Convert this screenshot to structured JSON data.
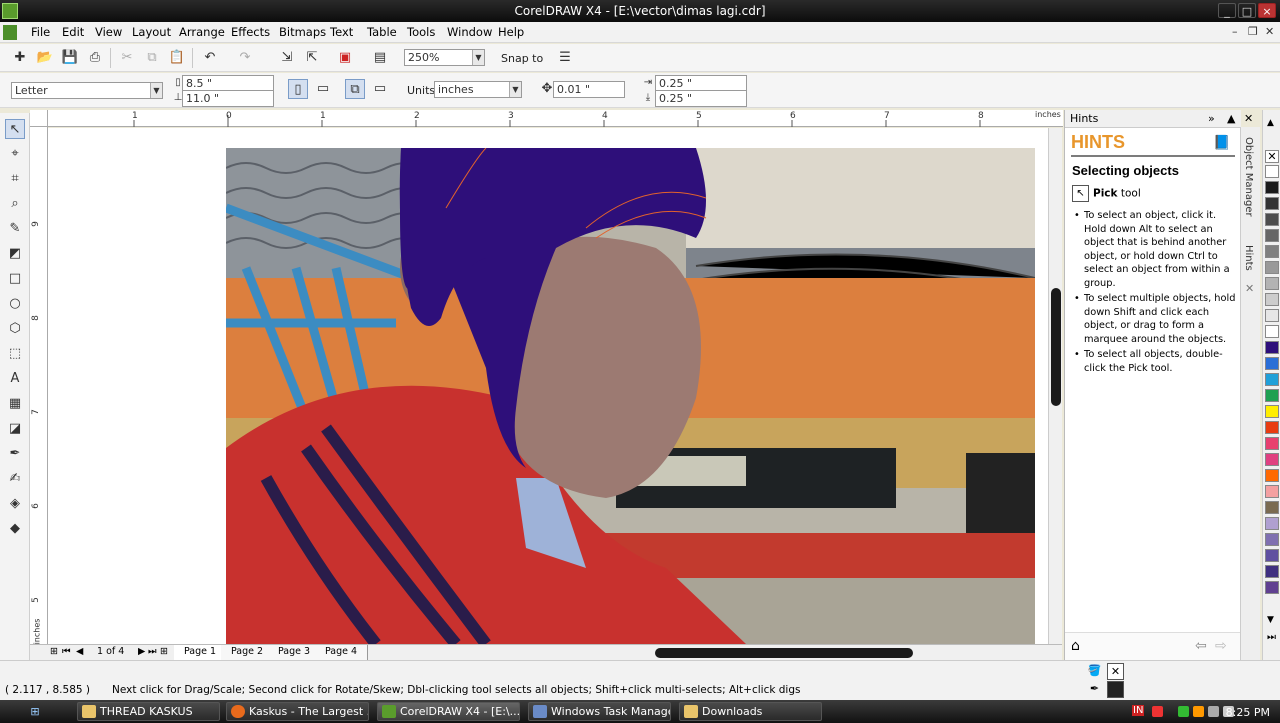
{
  "window": {
    "title": "CorelDRAW X4 - [E:\\vector\\dimas lagi.cdr]"
  },
  "menu": [
    "File",
    "Edit",
    "View",
    "Layout",
    "Arrange",
    "Effects",
    "Bitmaps",
    "Text",
    "Table",
    "Tools",
    "Window",
    "Help"
  ],
  "toolbar": {
    "zoom": "250%",
    "snap_label": "Snap to"
  },
  "property_bar": {
    "paper": "Letter",
    "width": "8.5 \"",
    "height": "11.0 \"",
    "units_label": "Units:",
    "units": "inches",
    "nudge": "0.01 \"",
    "dup_x": "0.25 \"",
    "dup_y": "0.25 \""
  },
  "ruler": {
    "unit": "inches",
    "h_ticks": [
      "1",
      "0",
      "1",
      "2",
      "3",
      "4",
      "5",
      "6",
      "7",
      "8"
    ],
    "v_ticks": [
      "9",
      "8",
      "7",
      "6",
      "5"
    ],
    "v_unit": "inches"
  },
  "pages": {
    "counter": "1 of 4",
    "tabs": [
      "Page 1",
      "Page 2",
      "Page 3",
      "Page 4"
    ]
  },
  "docker": {
    "header": "Hints",
    "big_title": "HINTS",
    "topic": "Selecting objects",
    "tool_name": "Pick",
    "tool_suffix": "tool",
    "bullets": [
      "To select an object, click it. Hold down Alt to select an object that is behind another object, or hold down Ctrl to select an object from within a group.",
      "To select multiple objects, hold down Shift and click each object, or drag to form a marquee around the objects.",
      "To select all objects, double-click the Pick tool."
    ],
    "side_tabs": [
      "Object Manager",
      "Hints"
    ]
  },
  "palette": [
    "#ffffff",
    "#1a1a1a",
    "#333333",
    "#4d4d4d",
    "#666666",
    "#808080",
    "#999999",
    "#b3b3b3",
    "#cccccc",
    "#e6e6e6",
    "#ffffff",
    "#2e0f7a",
    "#2a6fd6",
    "#1fa0d8",
    "#1fa050",
    "#ffee00",
    "#e83c10",
    "#e8406e",
    "#e04080",
    "#ff6a00",
    "#f4a0a0",
    "#7a6a50",
    "#b0a0d0",
    "#8070b0",
    "#6050a0",
    "#403080",
    "#604090"
  ],
  "status": {
    "coords": "( 2.117 , 8.585 )",
    "message": "Next click for Drag/Scale; Second click for Rotate/Skew; Dbl-clicking tool selects all objects; Shift+click multi-selects; Alt+click digs"
  },
  "taskbar": {
    "tasks": [
      "THREAD KASKUS",
      "Kaskus - The Largest ...",
      "CorelDRAW X4 - [E:\\...",
      "Windows Task Manager",
      "Downloads"
    ],
    "clock": "8:25 PM",
    "lang": "IN"
  }
}
